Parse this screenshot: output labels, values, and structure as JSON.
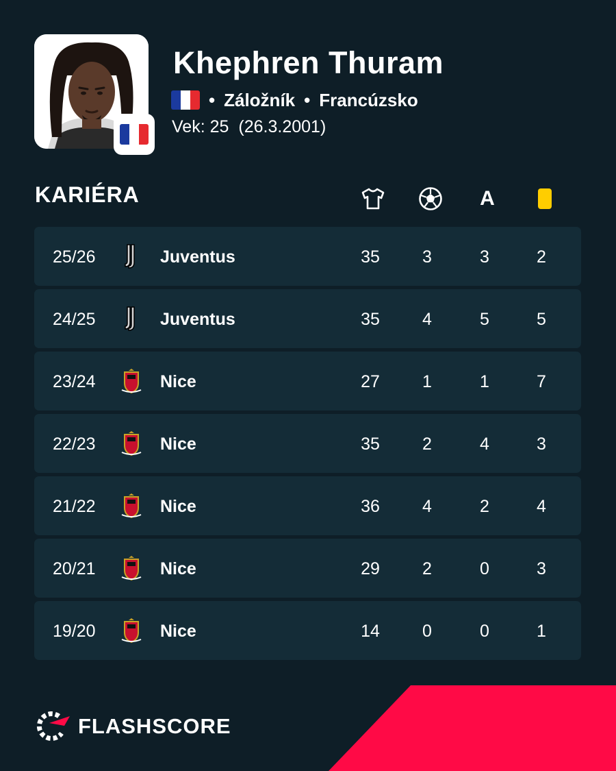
{
  "player": {
    "name": "Khephren Thuram",
    "position": "Záložník",
    "country": "Francúzsko",
    "age_text": "Vek: 25",
    "birth_date": "(26.3.2001)"
  },
  "career": {
    "title": "KARIÉRA",
    "columns": [
      {
        "icon": "jersey-icon"
      },
      {
        "icon": "football-icon"
      },
      {
        "icon": "assist-icon",
        "label": "A"
      },
      {
        "icon": "yellow-card-icon"
      }
    ],
    "rows": [
      {
        "season": "25/26",
        "team": "Juventus",
        "crest": "juventus",
        "apps": "35",
        "goals": "3",
        "assists": "3",
        "cards": "2"
      },
      {
        "season": "24/25",
        "team": "Juventus",
        "crest": "juventus",
        "apps": "35",
        "goals": "4",
        "assists": "5",
        "cards": "5"
      },
      {
        "season": "23/24",
        "team": "Nice",
        "crest": "nice",
        "apps": "27",
        "goals": "1",
        "assists": "1",
        "cards": "7"
      },
      {
        "season": "22/23",
        "team": "Nice",
        "crest": "nice",
        "apps": "35",
        "goals": "2",
        "assists": "4",
        "cards": "3"
      },
      {
        "season": "21/22",
        "team": "Nice",
        "crest": "nice",
        "apps": "36",
        "goals": "4",
        "assists": "2",
        "cards": "4"
      },
      {
        "season": "20/21",
        "team": "Nice",
        "crest": "nice",
        "apps": "29",
        "goals": "2",
        "assists": "0",
        "cards": "3"
      },
      {
        "season": "19/20",
        "team": "Nice",
        "crest": "nice",
        "apps": "14",
        "goals": "0",
        "assists": "0",
        "cards": "1"
      }
    ]
  },
  "brand": {
    "name": "FLASHSCORE"
  },
  "colors": {
    "background": "#0e1e27",
    "row": "#142c37",
    "accent": "#ff0a46",
    "yellow_card": "#ffcd00"
  }
}
